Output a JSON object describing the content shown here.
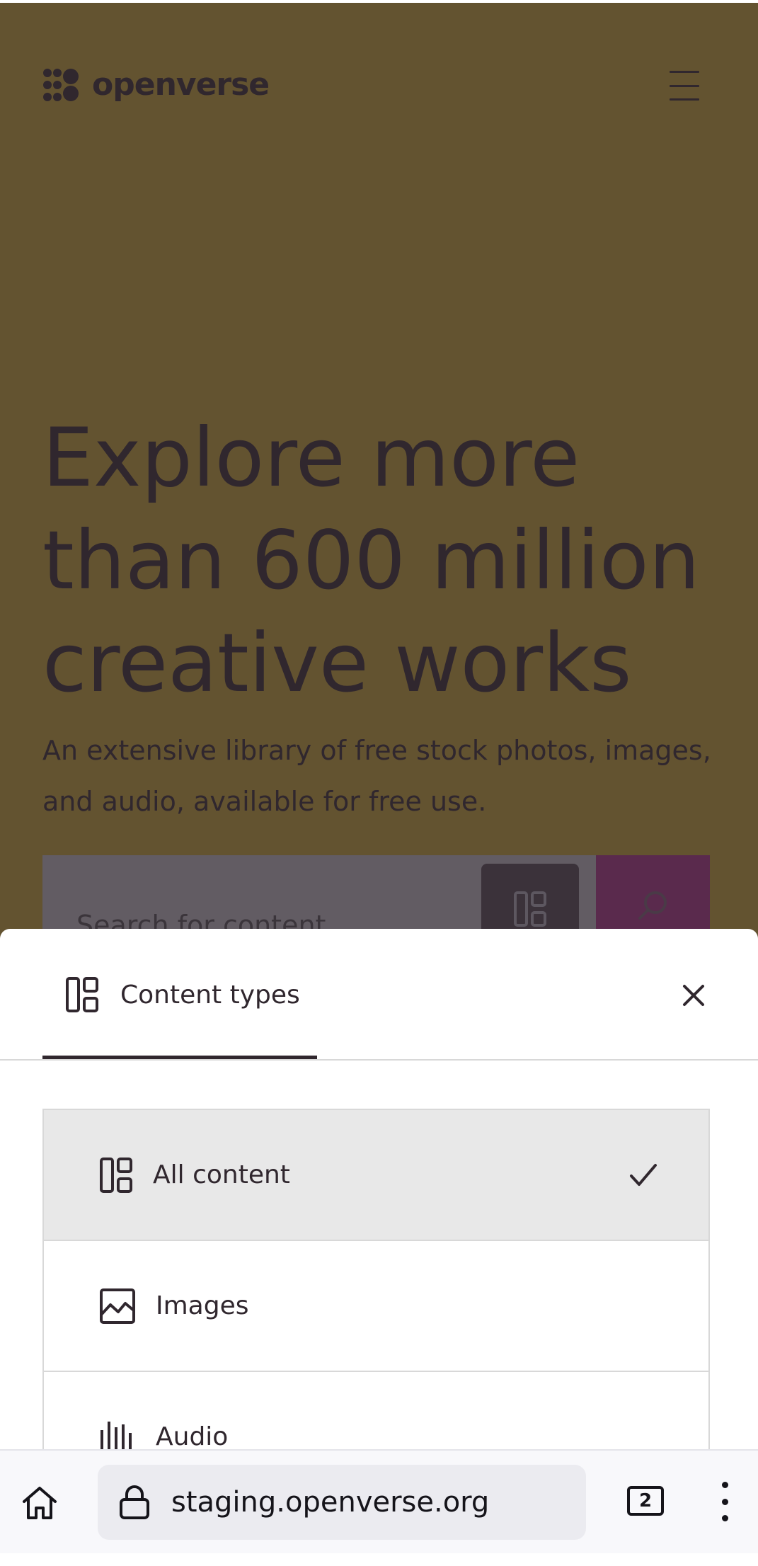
{
  "brand": {
    "name": "openverse",
    "logo_icon": "openverse-logo-icon"
  },
  "header": {
    "menu_icon": "hamburger-menu-icon"
  },
  "hero": {
    "title": "Explore more than 600 million creative works",
    "subtitle": "An extensive library of free stock photos, images, and audio, available for free use."
  },
  "search": {
    "placeholder": "Search for content",
    "content_type_icon": "all-content-icon",
    "submit_icon": "search-icon"
  },
  "content_sheet": {
    "tab_label": "Content types",
    "tab_icon": "all-content-icon",
    "close_icon": "close-icon",
    "options": [
      {
        "label": "All content",
        "icon": "all-content-icon",
        "selected": true
      },
      {
        "label": "Images",
        "icon": "image-icon",
        "selected": false
      },
      {
        "label": "Audio",
        "icon": "audio-icon",
        "selected": false
      }
    ]
  },
  "browser": {
    "url": "staging.openverse.org",
    "tab_count": "2",
    "home_icon": "home-icon",
    "lock_icon": "lock-icon",
    "menu_icon": "more-vertical-icon"
  },
  "colors": {
    "background": "#635330",
    "text": "#30272e",
    "search_button": "#5a2a4d",
    "selected_option": "#e8e8e8"
  }
}
